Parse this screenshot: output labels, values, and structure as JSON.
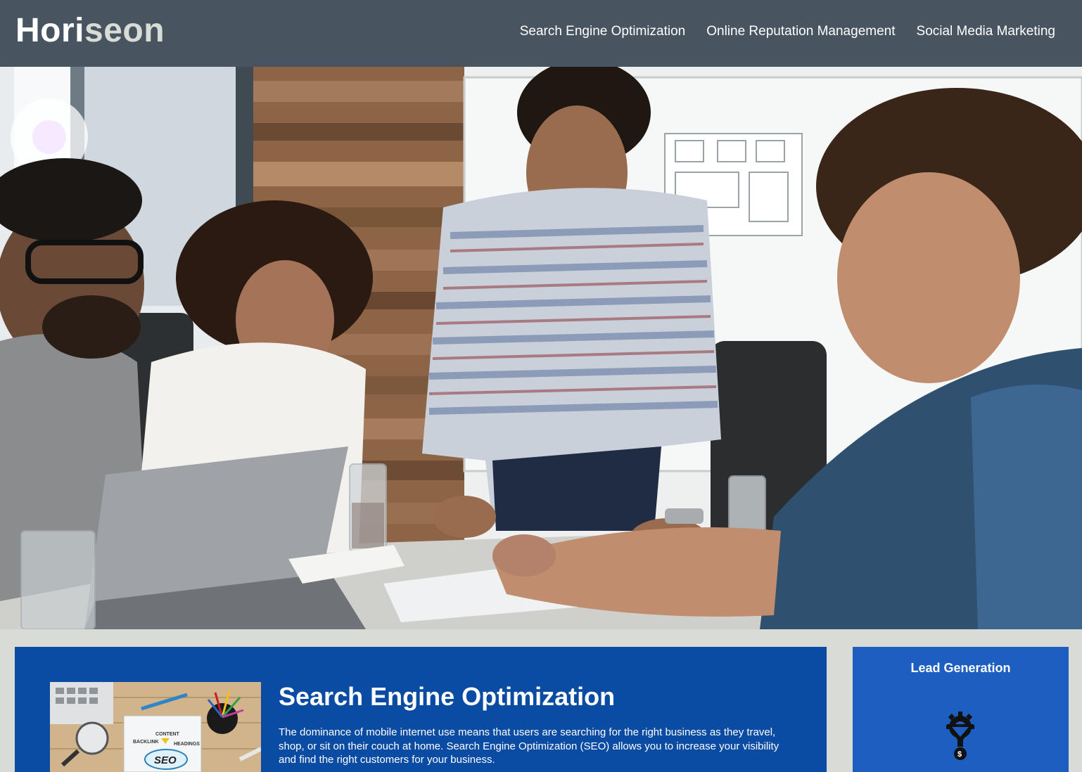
{
  "header": {
    "logo_main": "Hori",
    "logo_accent": "seon",
    "nav": [
      {
        "label": "Search Engine Optimization"
      },
      {
        "label": "Online Reputation Management"
      },
      {
        "label": "Social Media Marketing"
      }
    ]
  },
  "hero": {
    "image": "team-meeting-photo"
  },
  "content": {
    "image": "seo-desk-photo",
    "seo_doodle_text": "SEO",
    "doodle_words": [
      "CONTENT",
      "BACKLINK",
      "HEADINGS"
    ],
    "title": "Search Engine Optimization",
    "text": "The dominance of mobile internet use means that users are searching for the right business as they travel, shop, or sit on their couch at home. Search Engine Optimization (SEO) allows you to increase your visibility and find the right customers for your business."
  },
  "aside": {
    "title": "Lead Generation",
    "icon": "lead-funnel-gear-icon"
  },
  "colors": {
    "header_bg": "#485560",
    "page_bg": "#d9dcd6",
    "content_bg": "#0a4ca3",
    "aside_bg": "#1d5fc1"
  }
}
